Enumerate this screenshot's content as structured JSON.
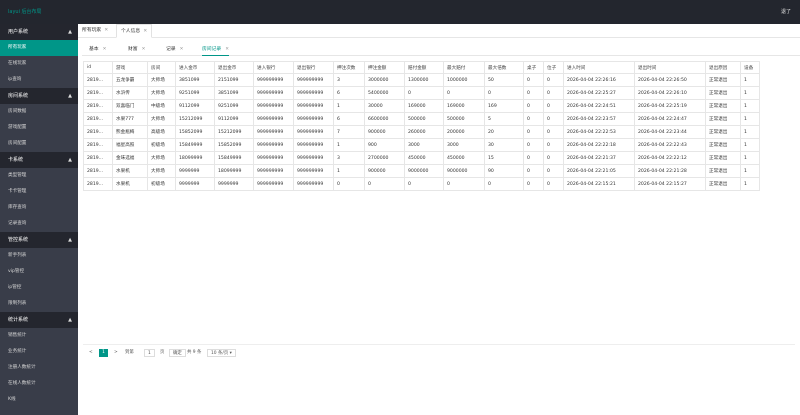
{
  "header": {
    "logo": "layui 后台布局",
    "logout": "退了"
  },
  "sidebar": [
    {
      "title": "用户系统",
      "items": [
        {
          "label": "所有玩家",
          "active": true
        },
        {
          "label": "在线玩家"
        },
        {
          "label": "ip查询"
        }
      ]
    },
    {
      "title": "房间系统",
      "items": [
        {
          "label": "房间数据"
        },
        {
          "label": "游戏配置"
        },
        {
          "label": "房间配置"
        }
      ]
    },
    {
      "title": "卡系统",
      "items": [
        {
          "label": "类型管理"
        },
        {
          "label": "卡卡管理"
        },
        {
          "label": "库存查询"
        },
        {
          "label": "记录查询"
        }
      ]
    },
    {
      "title": "管控系统",
      "items": [
        {
          "label": "新手列表"
        },
        {
          "label": "vip管控"
        },
        {
          "label": "ip管控"
        },
        {
          "label": "限制列表"
        }
      ]
    },
    {
      "title": "统计系统",
      "items": [
        {
          "label": "销售统计"
        },
        {
          "label": "业务统计"
        },
        {
          "label": "注册人数统计"
        },
        {
          "label": "在线人数统计"
        },
        {
          "label": "K线"
        }
      ]
    }
  ],
  "top_tabs": [
    {
      "label": "所有玩家",
      "closable": true
    },
    {
      "label": "个人信息",
      "closable": true,
      "active": true
    }
  ],
  "sub_tabs": [
    {
      "label": "基本"
    },
    {
      "label": "财富"
    },
    {
      "label": "记录"
    },
    {
      "label": "房间记录",
      "active": true
    }
  ],
  "table": {
    "columns": [
      "id",
      "游戏",
      "房间",
      "进入金币",
      "退出金币",
      "进入银行",
      "退出银行",
      "押注次数",
      "押注金额",
      "赔付金额",
      "最大赔付",
      "最大倍数",
      "桌子",
      "位子",
      "进入时间",
      "退出时间",
      "退出原因",
      "设备"
    ],
    "rows": [
      [
        "2819...",
        "五龙争霸",
        "大师场",
        "3851099",
        "2151099",
        "999999999",
        "999999999",
        "3",
        "3000000",
        "1300000",
        "1000000",
        "50",
        "0",
        "0",
        "2026-04-04 22:26:16",
        "2026-04-04 22:26:50",
        "正常退出",
        "1"
      ],
      [
        "2819...",
        "水浒传",
        "大师场",
        "9251099",
        "3851099",
        "999999999",
        "999999999",
        "6",
        "5400000",
        "0",
        "0",
        "0",
        "0",
        "0",
        "2026-04-04 22:25:27",
        "2026-04-04 22:26:10",
        "正常退出",
        "1"
      ],
      [
        "2819...",
        "双喜临门",
        "中级场",
        "9112099",
        "9251099",
        "999999999",
        "999999999",
        "1",
        "30000",
        "169000",
        "169000",
        "169",
        "0",
        "0",
        "2026-04-04 22:24:51",
        "2026-04-04 22:25:19",
        "正常退出",
        "1"
      ],
      [
        "2819...",
        "水果777",
        "大师场",
        "15212099",
        "9112099",
        "999999999",
        "999999999",
        "6",
        "6600000",
        "500000",
        "500000",
        "5",
        "0",
        "0",
        "2026-04-04 22:23:57",
        "2026-04-04 22:24:47",
        "正常退出",
        "1"
      ],
      [
        "2819...",
        "熊金瓶梅",
        "高级场",
        "15852099",
        "15212099",
        "999999999",
        "999999999",
        "7",
        "900000",
        "260000",
        "200000",
        "20",
        "0",
        "0",
        "2026-04-04 22:22:53",
        "2026-04-04 22:23:44",
        "正常退出",
        "1"
      ],
      [
        "2819...",
        "福星高照",
        "初级场",
        "15849999",
        "15852099",
        "999999999",
        "999999999",
        "1",
        "900",
        "3000",
        "3000",
        "30",
        "0",
        "0",
        "2026-04-04 22:22:18",
        "2026-04-04 22:22:43",
        "正常退出",
        "1"
      ],
      [
        "2819...",
        "金味选福",
        "大师场",
        "18099999",
        "15849999",
        "999999999",
        "999999999",
        "3",
        "2700000",
        "450000",
        "450000",
        "15",
        "0",
        "0",
        "2026-04-04 22:21:37",
        "2026-04-04 22:22:12",
        "正常退出",
        "1"
      ],
      [
        "2819...",
        "水果机",
        "大师场",
        "9999999",
        "18099999",
        "999999999",
        "999999999",
        "1",
        "900000",
        "9000000",
        "9000000",
        "90",
        "0",
        "0",
        "2026-04-04 22:21:05",
        "2026-04-04 22:21:28",
        "正常退出",
        "1"
      ],
      [
        "2819...",
        "水果机",
        "初级场",
        "9999999",
        "9999999",
        "999999999",
        "999999999",
        "0",
        "0",
        "0",
        "0",
        "0",
        "0",
        "0",
        "2026-04-04 22:15:21",
        "2026-04-04 22:15:27",
        "正常退出",
        "1"
      ]
    ]
  },
  "pager": {
    "prev": "<",
    "current": "1",
    "next": ">",
    "goto_label": "到第",
    "goto_value": "1",
    "page_unit": "页",
    "confirm": "确定",
    "total": "共 9 条",
    "page_size": "10 条/页"
  }
}
